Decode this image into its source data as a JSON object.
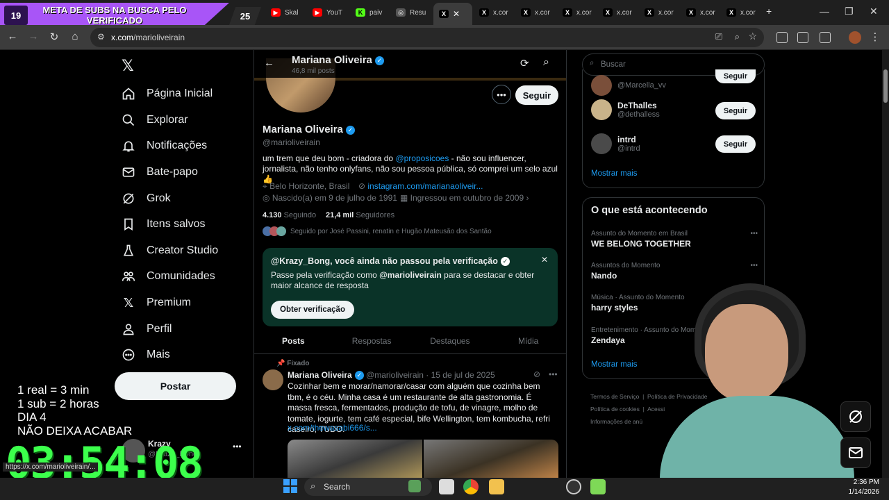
{
  "stream_overlay": {
    "counter_left": "19",
    "banner_text": "META DE SUBS NA BUSCA PELO VERIFICADO",
    "counter_right": "25",
    "info_lines": [
      "1 real = 3 min",
      "1 sub = 2 horas",
      "DIA 4",
      "NÃO DEIXA ACABAR"
    ],
    "timer": "03:54:08"
  },
  "browser": {
    "tabs": [
      {
        "label": "Skal",
        "icon": "youtube-icon",
        "color": "#ff0000"
      },
      {
        "label": "YouT",
        "icon": "youtube-icon",
        "color": "#ff0000"
      },
      {
        "label": "paiv",
        "icon": "kick-icon",
        "color": "#53fc18"
      },
      {
        "label": "Resu",
        "icon": "globe-icon",
        "color": "#555555"
      },
      {
        "label": "",
        "icon": "x-icon",
        "color": "#000000"
      },
      {
        "label": "x.cor",
        "icon": "x-icon",
        "color": "#000000"
      },
      {
        "label": "x.cor",
        "icon": "x-icon",
        "color": "#000000"
      },
      {
        "label": "x.cor",
        "icon": "x-icon",
        "color": "#000000"
      },
      {
        "label": "x.cor",
        "icon": "x-icon",
        "color": "#000000"
      },
      {
        "label": "x.cor",
        "icon": "x-icon",
        "color": "#000000"
      },
      {
        "label": "x.cor",
        "icon": "x-icon",
        "color": "#000000"
      },
      {
        "label": "x.cor",
        "icon": "x-icon",
        "color": "#000000"
      }
    ],
    "url_host": "x.com",
    "url_path": "/marioliveirain",
    "status_url": "https://x.com/marioliveirain/..."
  },
  "nav": {
    "items": [
      "Página Inicial",
      "Explorar",
      "Notificações",
      "Bate-papo",
      "Grok",
      "Itens salvos",
      "Creator Studio",
      "Comunidades",
      "Premium",
      "Perfil",
      "Mais"
    ],
    "post_button": "Postar",
    "account_name": "Krazy",
    "account_handle": "@Krazy_Bong"
  },
  "profile": {
    "header_name": "Mariana Oliveira",
    "header_posts": "46,8 mil posts",
    "name": "Mariana Oliveira",
    "handle": "@marioliveirain",
    "follow_button": "Seguir",
    "bio_1": "um trem que deu bom - criadora do ",
    "bio_link": "@proposicoes",
    "bio_2": " - não sou influencer, jornalista, não tenho onlyfans, não sou pessoa pública, só comprei um selo azul 👍",
    "location": "Belo Horizonte, Brasil",
    "website": "instagram.com/marianaoliveir...",
    "birth": "Nascido(a) em 9 de julho de 1991",
    "joined": "Ingressou em outubro de 2009",
    "following_count": "4.130",
    "following_label": "Seguindo",
    "followers_count": "21,4 mil",
    "followers_label": "Seguidores",
    "followed_by": "Seguido por José Passini, renatin e Hugão Mateusão dos Santão"
  },
  "verification_card": {
    "title": "@Krazy_Bong, você ainda não passou pela verificação",
    "text_1": "Passe pela verificação como ",
    "text_handle": "@marioliveirain",
    "text_2": " para se destacar e obter maior alcance de resposta",
    "button": "Obter verificação"
  },
  "tabs": [
    "Posts",
    "Respostas",
    "Destaques",
    "Mídia"
  ],
  "pinned_tweet": {
    "pinned_label": "Fixado",
    "name": "Mariana Oliveira",
    "handle": "@marioliveirain",
    "date": "· 15 de jul de 2025",
    "text": "Cozinhar bem e morar/namorar/casar com alguém que cozinha bem tbm, é o céu. Minha casa é um restaurante de alta gastronomia. É massa fresca, fermentados, produção de tofu, de vinagre, molho de tomate, iogurte, tem café especial, bife Wellington, tem kombucha, refri caseiro, TUDO.",
    "link": "x.com/thewasabi666/s..."
  },
  "right": {
    "search_placeholder": "Buscar",
    "who_to_follow": [
      {
        "name": "",
        "handle": "@Marcella_vv",
        "button": "Seguir"
      },
      {
        "name": "DeThalles",
        "handle": "@dethalless",
        "button": "Seguir"
      },
      {
        "name": "intrd",
        "handle": "@intrd",
        "button": "Seguir"
      }
    ],
    "show_more": "Mostrar mais",
    "trends_title": "O que está acontecendo",
    "trends": [
      {
        "category": "Assunto do Momento em Brasil",
        "title": "WE BELONG TOGETHER"
      },
      {
        "category": "Assuntos do Momento",
        "title": "Nando"
      },
      {
        "category": "Música · Assunto do Momento",
        "title": "harry styles"
      },
      {
        "category": "Entretenimento · Assunto do Mom",
        "title": "Zendaya"
      }
    ],
    "trends_more": "Mostrar mais",
    "footer": [
      "Termos de Serviço",
      "Política de Privacidade",
      "Política de cookies",
      "Acessi",
      "Informações de anú"
    ]
  },
  "taskbar": {
    "search": "Search",
    "time": "2:36 PM",
    "date": "1/14/2026"
  },
  "colors": {
    "accent": "#1d9bf0",
    "timer": "#3cff4c",
    "overlay": "#a855f7",
    "verif_card": "#0a3328"
  }
}
